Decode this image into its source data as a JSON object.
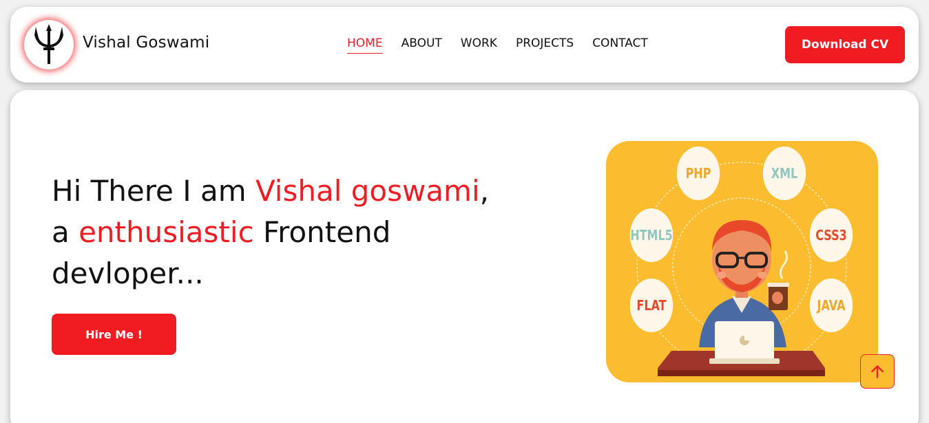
{
  "header": {
    "brand_name": "Vishal Goswami",
    "download_label": "Download CV"
  },
  "nav": {
    "items": [
      {
        "label": "HOME",
        "active": true
      },
      {
        "label": "ABOUT",
        "active": false
      },
      {
        "label": "WORK",
        "active": false
      },
      {
        "label": "PROJECTS",
        "active": false
      },
      {
        "label": "CONTACT",
        "active": false
      }
    ]
  },
  "hero": {
    "line1_prefix": "Hi There I am ",
    "line1_name": "Vishal goswami",
    "line1_suffix": ",",
    "line2_prefix": "a ",
    "line2_accent": "enthusiastic",
    "line2_suffix": " Frontend",
    "line3": "devloper...",
    "hire_label": "Hire Me !"
  },
  "illustration": {
    "bubbles": {
      "php": "PHP",
      "xml": "XML",
      "html5": "HTML5",
      "css3": "CSS3",
      "flat": "FLAT",
      "java": "JAVA"
    }
  },
  "icons": {
    "logo": "trident-icon",
    "scroll_top": "arrow-up-icon"
  },
  "colors": {
    "accent": "#f01c22",
    "illustration_bg": "#fbbd2f",
    "text": "#111111"
  }
}
